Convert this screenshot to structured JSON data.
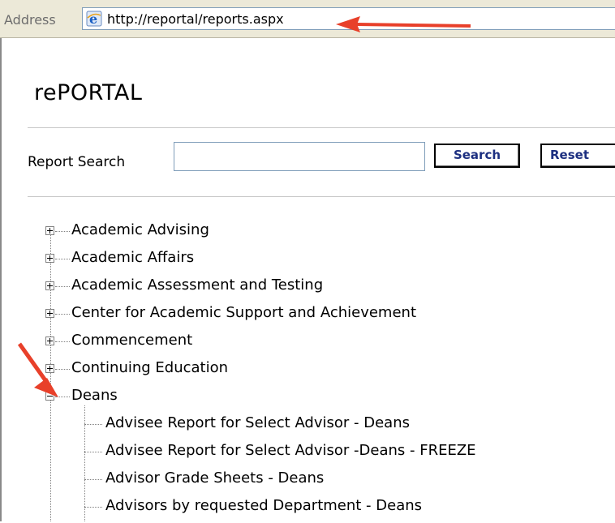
{
  "address_bar": {
    "label": "Address",
    "url": "http://reportal/reports.aspx"
  },
  "page": {
    "title": "rePORTAL",
    "search": {
      "label": "Report Search",
      "value": "",
      "search_button": "Search",
      "reset_button": "Reset"
    }
  },
  "tree": {
    "categories": [
      {
        "label": "Academic Advising",
        "expanded": false
      },
      {
        "label": "Academic Affairs",
        "expanded": false
      },
      {
        "label": "Academic Assessment and Testing",
        "expanded": false
      },
      {
        "label": "Center for Academic Support and Achievement",
        "expanded": false
      },
      {
        "label": "Commencement",
        "expanded": false
      },
      {
        "label": "Continuing Education",
        "expanded": false
      },
      {
        "label": "Deans",
        "expanded": true
      }
    ],
    "deans_reports": [
      "Advisee Report for Select Advisor - Deans",
      "Advisee Report for Select Advisor -Deans - FREEZE",
      "Advisor Grade Sheets - Deans",
      "Advisors by requested Department - Deans"
    ]
  },
  "colors": {
    "annotation_arrow": "#e8402a",
    "button_text": "#1c2f80"
  }
}
